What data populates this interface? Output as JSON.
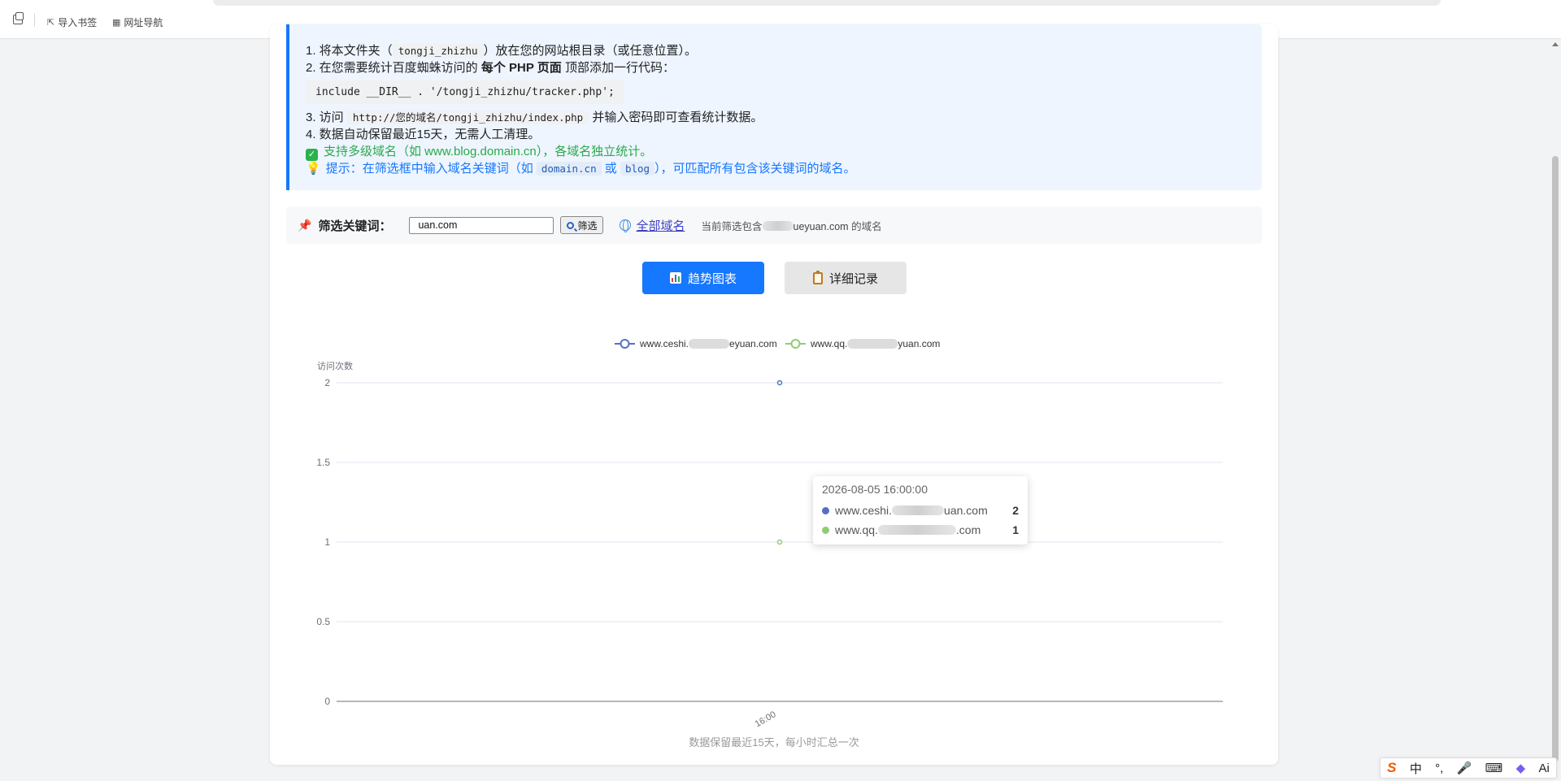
{
  "bookmarks": [
    {
      "label": "导入书签",
      "icon": "import-bookmark-icon"
    },
    {
      "label": "网址导航",
      "icon": "grid-nav-icon"
    }
  ],
  "instructions": {
    "step1_prefix": "1. 将本文件夹（",
    "step1_code": "tongji_zhizhu",
    "step1_suffix": "）放在您的网站根目录（或任意位置）。",
    "step2_prefix": "2. 在您需要统计百度蜘蛛访问的 ",
    "step2_bold": "每个 PHP 页面",
    "step2_suffix": " 顶部添加一行代码：",
    "code_line": "include __DIR__ . '/tongji_zhizhu/tracker.php';",
    "step3_prefix": "3. 访问 ",
    "step3_code": "http://您的域名/tongji_zhizhu/index.php",
    "step3_suffix": " 并输入密码即可查看统计数据。",
    "step4": "4. 数据自动保留最近15天，无需人工清理。",
    "support_note": "支持多级域名（如 www.blog.domain.cn），各域名独立统计。",
    "tip_prefix": "提示：在筛选框中输入域名关键词（如 ",
    "tip_code1": "domain.cn",
    "tip_or": " 或 ",
    "tip_code2": "blog",
    "tip_suffix": "），可匹配所有包含该关键词的域名。"
  },
  "filter": {
    "label": "筛选关键词：",
    "value": "uan.com",
    "button_label": "筛选",
    "all_domains_label": "全部域名",
    "current_prefix": "当前筛选包含",
    "current_value": "ueyuan.com",
    "current_suffix": " 的域名"
  },
  "tabs": {
    "trend_label": "趋势图表",
    "detail_label": "详细记录"
  },
  "chart_data": {
    "type": "line",
    "ylabel": "访问次数",
    "ylim": [
      0,
      2
    ],
    "yticks": [
      "0",
      "0.5",
      "1",
      "1.5",
      "2"
    ],
    "categories": [
      "16:00"
    ],
    "series": [
      {
        "name": "www.ceshi.",
        "name_suffix": "eyuan.com",
        "values": [
          2
        ],
        "color": "#5470c6"
      },
      {
        "name": "www.qq.",
        "name_suffix": "yuan.com",
        "values": [
          1
        ],
        "color": "#91cc75"
      }
    ],
    "legend_position": "top-center",
    "grid": true
  },
  "tooltip": {
    "title": "2026-08-05 16:00:00",
    "rows": [
      {
        "name_prefix": "www.ceshi.",
        "name_suffix": "uan.com",
        "value": "2"
      },
      {
        "name_prefix": "www.qq.",
        "name_suffix": ".com",
        "value": "1"
      }
    ]
  },
  "footer_note": "数据保留最近15天，每小时汇总一次",
  "ime": {
    "logo": "S",
    "lang": "中",
    "items": [
      "punct-icon",
      "mic-icon",
      "keyboard-icon",
      "skin-icon",
      "ai-icon"
    ],
    "ai_label": "Ai"
  }
}
